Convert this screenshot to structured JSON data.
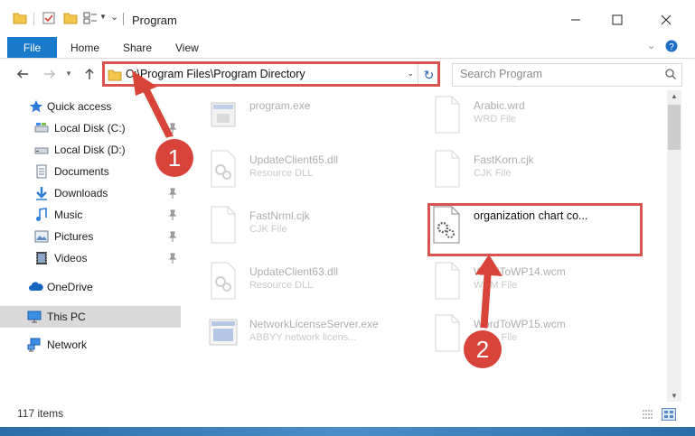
{
  "window": {
    "title": "Program",
    "controls": [
      "minimize",
      "maximize",
      "close"
    ]
  },
  "ribbon": {
    "tabs": [
      {
        "label": "File",
        "active": true
      },
      {
        "label": "Home"
      },
      {
        "label": "Share"
      },
      {
        "label": "View"
      }
    ]
  },
  "address": {
    "path": "C:\\Program Files\\Program Directory"
  },
  "search": {
    "placeholder": "Search Program"
  },
  "nav": {
    "items": [
      {
        "label": "Quick access",
        "icon": "star-icon"
      },
      {
        "label": "Local Disk (C:)",
        "icon": "drive-icon",
        "pinned": true
      },
      {
        "label": "Local Disk (D:)",
        "icon": "drive-icon"
      },
      {
        "label": "Documents",
        "icon": "documents-icon"
      },
      {
        "label": "Downloads",
        "icon": "downloads-icon",
        "pinned": true
      },
      {
        "label": "Music",
        "icon": "music-icon",
        "pinned": true
      },
      {
        "label": "Pictures",
        "icon": "pictures-icon",
        "pinned": true
      },
      {
        "label": "Videos",
        "icon": "videos-icon",
        "pinned": true
      },
      {
        "label": "OneDrive",
        "icon": "onedrive-icon"
      },
      {
        "label": "This PC",
        "icon": "this-pc-icon",
        "selected": true
      },
      {
        "label": "Network",
        "icon": "network-icon"
      }
    ]
  },
  "files": [
    {
      "name": "program.exe",
      "type": ""
    },
    {
      "name": "Arabic.wrd",
      "type": "WRD File"
    },
    {
      "name": "UpdateClient65.dll",
      "type": "Resource DLL"
    },
    {
      "name": "FastKorn.cjk",
      "type": "CJK File"
    },
    {
      "name": "FastNrml.cjk",
      "type": "CJK File"
    },
    {
      "name": "organization chart co...",
      "type": "",
      "highlighted": true
    },
    {
      "name": "UpdateClient63.dll",
      "type": "Resource DLL"
    },
    {
      "name": "WordToWP14.wcm",
      "type": "WCM File"
    },
    {
      "name": "NetworkLicenseServer.exe",
      "type": "ABBYY network licens..."
    },
    {
      "name": "WordToWP15.wcm",
      "type": "WCM File"
    }
  ],
  "status": {
    "item_count": "117 items"
  },
  "annotations": {
    "step1": "1",
    "step2": "2",
    "color": "#d9443a"
  }
}
